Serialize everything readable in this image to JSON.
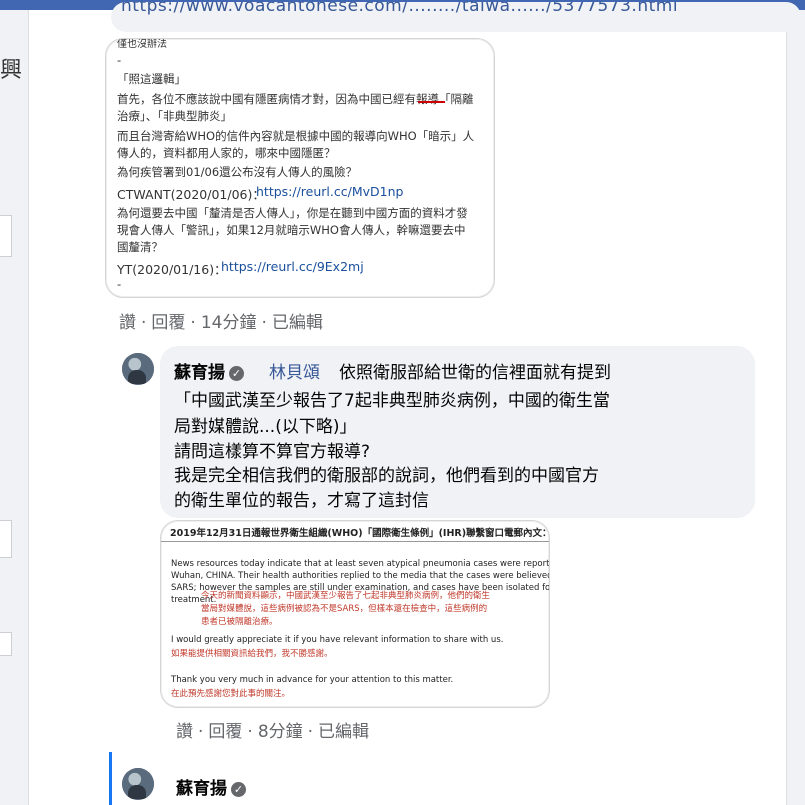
{
  "top_link": "https://www.voacantonese.com/......../taiwa....../5377573.html",
  "left_strip": {
    "glyph": "興"
  },
  "post_image_1": {
    "lines": [
      "僅也沒辦法",
      "-",
      "「照這邏輯」",
      "首先，各位不應該說中國有隱匿病情才對，因為中國已經有報導「隔離",
      "治療」、「非典型肺炎」",
      "而且台灣寄給WHO的信件內容就是根據中國的報導向WHO「暗示」人",
      "傳人的，資料都用人家的，哪來中國隱匿？",
      "為何疾管署到01/06還公布沒有人傳人的風險？",
      "CTWANT(2020/01/06)：",
      "https://reurl.cc/MvD1np",
      "為何還要去中國「釐清是否人傳人」，你是在聽到中國方面的資料才發",
      "現會人傳人「警訊」，如果12月就暗示WHO會人傳人，幹嘛還要去中",
      "國釐清？",
      "YT(2020/01/16)：",
      "https://reurl.cc/9Ex2mj",
      "-"
    ]
  },
  "comment_1_actions": {
    "like": "讚",
    "reply": "回覆",
    "time": "14分鐘",
    "edited": "已編輯"
  },
  "reply_1": {
    "author": "蘇育揚",
    "mention": "林貝頌",
    "lines": [
      "依照衛服部給世衛的信裡面就有提到",
      "「中國武漢至少報告了7起非典型肺炎病例，中國的衛生當",
      "局對媒體說...(以下略)」",
      "請問這樣算不算官方報導?",
      "我是完全相信我們的衛服部的說詞，他們看到的中國官方",
      "的衛生單位的報告，才寫了這封信"
    ]
  },
  "reply_image": {
    "title": "2019年12月31日通報世界衛生組織(WHO)「國際衛生條例」(IHR)聯繫窗口電郵內文：",
    "en_1": [
      "News resources today indicate that at least seven atypical pneumonia cases were reported in",
      "Wuhan, CHINA. Their health authorities replied to the media that the cases were believed not",
      "SARS; however the samples are still under examination, and cases have been isolated for",
      "treatment."
    ],
    "zh_1": [
      "今天的新聞資料顯示，中國武漢至少報告了七起非典型肺炎病例，他們的衛生",
      "當局對媒體說，這些病例被認為不是SARS，但樣本還在檢查中，這些病例的",
      "患者已被隔離治療。"
    ],
    "en_2": "I would greatly appreciate it if you have relevant information to share with us.",
    "zh_2": "如果能提供相關資訊給我們，我不勝感謝。",
    "en_3": "Thank you very much in advance for your attention to this matter.",
    "zh_3": "在此預先感謝您對此事的關注。"
  },
  "reply_1_actions": {
    "like": "讚",
    "reply": "回覆",
    "time": "8分鐘",
    "edited": "已編輯"
  },
  "reply_2": {
    "author": "蘇育揚"
  }
}
